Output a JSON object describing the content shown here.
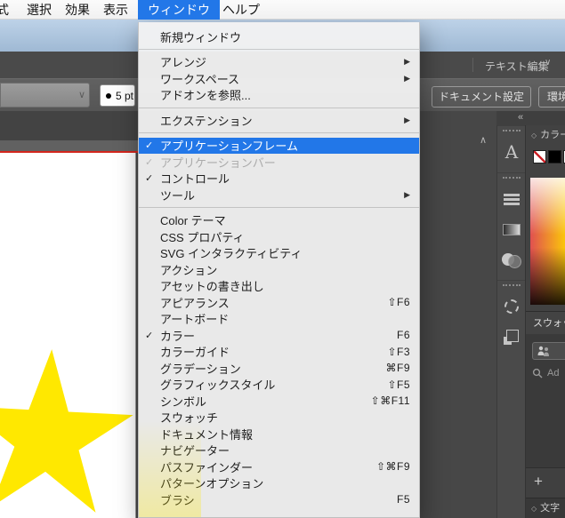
{
  "menubar": {
    "items": [
      {
        "label": "式"
      },
      {
        "label": "選択"
      },
      {
        "label": "効果"
      },
      {
        "label": "表示"
      },
      {
        "label": "ウィンドウ",
        "selected": true
      },
      {
        "label": "ヘルプ"
      }
    ]
  },
  "window_menu": {
    "items": [
      {
        "label": "新規ウィンドウ"
      },
      {
        "label": "アレンジ",
        "arrow": "▶"
      },
      {
        "label": "ワークスペース",
        "arrow": "▶"
      },
      {
        "label": "アドオンを参照..."
      },
      {
        "label": "エクステンション",
        "arrow": "▶"
      },
      {
        "label": "アプリケーションフレーム",
        "check": "✓",
        "highlighted": true
      },
      {
        "label": "アプリケーションバー",
        "check": "✓",
        "disabled": true
      },
      {
        "label": "コントロール",
        "check": "✓"
      },
      {
        "label": "ツール",
        "arrow": "▶"
      },
      {
        "label": "Color テーマ"
      },
      {
        "label": "CSS プロパティ"
      },
      {
        "label": "SVG インタラクティビティ"
      },
      {
        "label": "アクション"
      },
      {
        "label": "アセットの書き出し"
      },
      {
        "label": "アピアランス",
        "shortcut": "⇧F6"
      },
      {
        "label": "アートボード"
      },
      {
        "label": "カラー",
        "check": "✓",
        "shortcut": "F6"
      },
      {
        "label": "カラーガイド",
        "shortcut": "⇧F3"
      },
      {
        "label": "グラデーション",
        "shortcut": "⌘F9"
      },
      {
        "label": "グラフィックスタイル",
        "shortcut": "⇧F5"
      },
      {
        "label": "シンボル",
        "shortcut": "⇧⌘F11"
      },
      {
        "label": "スウォッチ"
      },
      {
        "label": "ドキュメント情報"
      },
      {
        "label": "ナビゲーター"
      },
      {
        "label": "パスファインダー",
        "shortcut": "⇧⌘F9"
      },
      {
        "label": "パターンオプション"
      },
      {
        "label": "ブラシ",
        "shortcut": "F5"
      }
    ]
  },
  "workspace_bar": {
    "workspace_label": "テキスト編集",
    "chevron": "∨"
  },
  "control_bar": {
    "combo_chevron": "∨",
    "stroke_value": "5 pt",
    "doc_setup_label": "ドキュメント設定",
    "prefs_label": "環境設定"
  },
  "pasteboard": {
    "scroll_chevron": "∧"
  },
  "dock": {
    "collapse_icon": "«"
  },
  "panels": {
    "color": {
      "collapse_glyph": "◇",
      "title": "カラー"
    },
    "swatches": {
      "title": "スウォッチ",
      "search_text": "Ad",
      "add_label": "+"
    },
    "bottom_tab": {
      "collapse_glyph": "◇",
      "title": "文字"
    }
  },
  "colors": {
    "menu_highlight_blue": "#2277e8",
    "star_yellow": "#ffe800",
    "guide_red": "#d3261d",
    "app_chrome_gray": "#4a4a4a"
  }
}
